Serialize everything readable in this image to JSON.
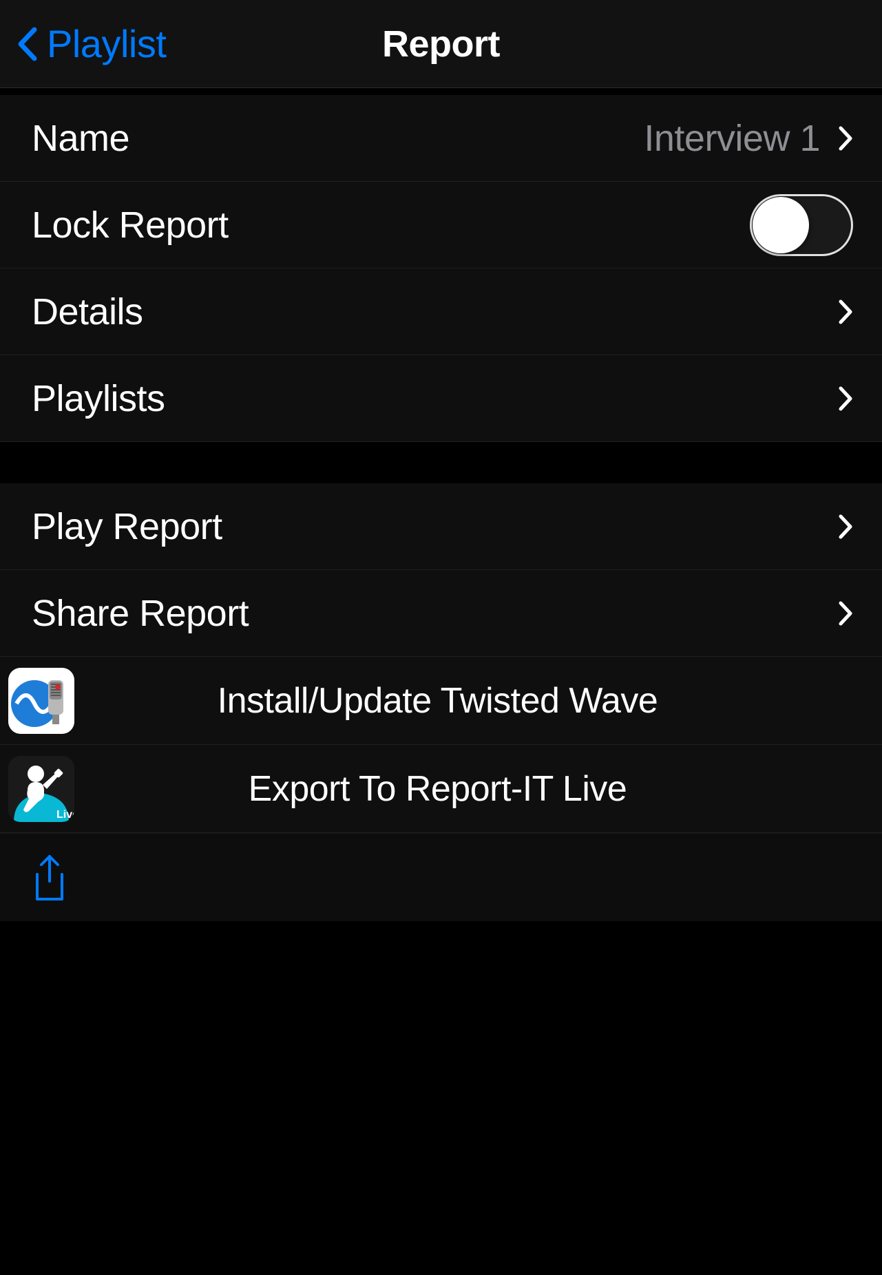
{
  "nav": {
    "back_label": "Playlist",
    "title": "Report"
  },
  "rows": {
    "name": {
      "label": "Name",
      "value": "Interview 1"
    },
    "lock": {
      "label": "Lock Report",
      "on": false
    },
    "details": {
      "label": "Details"
    },
    "playlists": {
      "label": "Playlists"
    },
    "play": {
      "label": "Play Report"
    },
    "share": {
      "label": "Share Report"
    }
  },
  "actions": {
    "twisted_wave": {
      "label": "Install/Update Twisted Wave"
    },
    "reportit": {
      "label": "Export To Report-IT Live",
      "badge": "Live"
    }
  },
  "colors": {
    "accent": "#007aff",
    "background": "#000000",
    "row": "#0f0f0f",
    "text_secondary": "#8e8e93"
  }
}
